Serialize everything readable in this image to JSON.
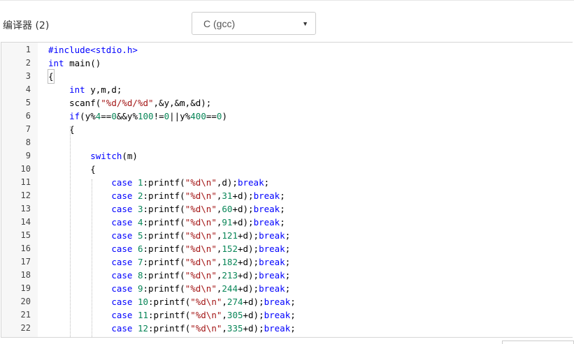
{
  "compiler": {
    "label": "编译器 (2)",
    "language_selected": "C (gcc)",
    "caret_icon": "triangle-down"
  },
  "editor": {
    "lines": [
      {
        "n": "1",
        "code": "#include<stdio.h>"
      },
      {
        "n": "2",
        "code": "int main()"
      },
      {
        "n": "3",
        "code": "{"
      },
      {
        "n": "4",
        "code": "    int y,m,d;"
      },
      {
        "n": "5",
        "code": "    scanf(\"%d/%d/%d\",&y,&m,&d);"
      },
      {
        "n": "6",
        "code": "    if(y%4==0&&y%100!=0||y%400==0)"
      },
      {
        "n": "7",
        "code": "    {"
      },
      {
        "n": "8",
        "code": ""
      },
      {
        "n": "9",
        "code": "        switch(m)"
      },
      {
        "n": "10",
        "code": "        {"
      },
      {
        "n": "11",
        "code": "            case 1:printf(\"%d\\n\",d);break;"
      },
      {
        "n": "12",
        "code": "            case 2:printf(\"%d\\n\",31+d);break;"
      },
      {
        "n": "13",
        "code": "            case 3:printf(\"%d\\n\",60+d);break;"
      },
      {
        "n": "14",
        "code": "            case 4:printf(\"%d\\n\",91+d);break;"
      },
      {
        "n": "15",
        "code": "            case 5:printf(\"%d\\n\",121+d);break;"
      },
      {
        "n": "16",
        "code": "            case 6:printf(\"%d\\n\",152+d);break;"
      },
      {
        "n": "17",
        "code": "            case 7:printf(\"%d\\n\",182+d);break;"
      },
      {
        "n": "18",
        "code": "            case 8:printf(\"%d\\n\",213+d);break;"
      },
      {
        "n": "19",
        "code": "            case 9:printf(\"%d\\n\",244+d);break;"
      },
      {
        "n": "20",
        "code": "            case 10:printf(\"%d\\n\",274+d);break;"
      },
      {
        "n": "21",
        "code": "            case 11:printf(\"%d\\n\",305+d);break;"
      },
      {
        "n": "22",
        "code": "            case 12:printf(\"%d\\n\",335+d);break;"
      }
    ]
  }
}
